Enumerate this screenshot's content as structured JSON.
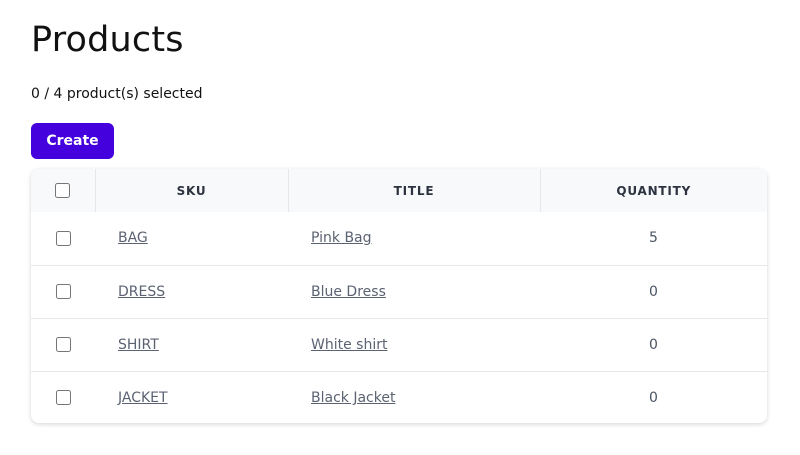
{
  "page": {
    "title": "Products",
    "selection_summary": "0 / 4 product(s) selected",
    "create_label": "Create"
  },
  "table": {
    "headers": {
      "sku": "SKU",
      "title": "TITLE",
      "quantity": "QUANTITY"
    },
    "select_all_checked": false,
    "rows": [
      {
        "sku": "BAG",
        "title": "Pink Bag",
        "quantity": "5",
        "selected": false
      },
      {
        "sku": "DRESS",
        "title": "Blue Dress",
        "quantity": "0",
        "selected": false
      },
      {
        "sku": "SHIRT",
        "title": "White shirt",
        "quantity": "0",
        "selected": false
      },
      {
        "sku": "JACKET",
        "title": "Black Jacket",
        "quantity": "0",
        "selected": false
      }
    ]
  },
  "colors": {
    "accent": "#4400dd",
    "header_background": "#f8f9fb",
    "link": "#5b6271"
  }
}
